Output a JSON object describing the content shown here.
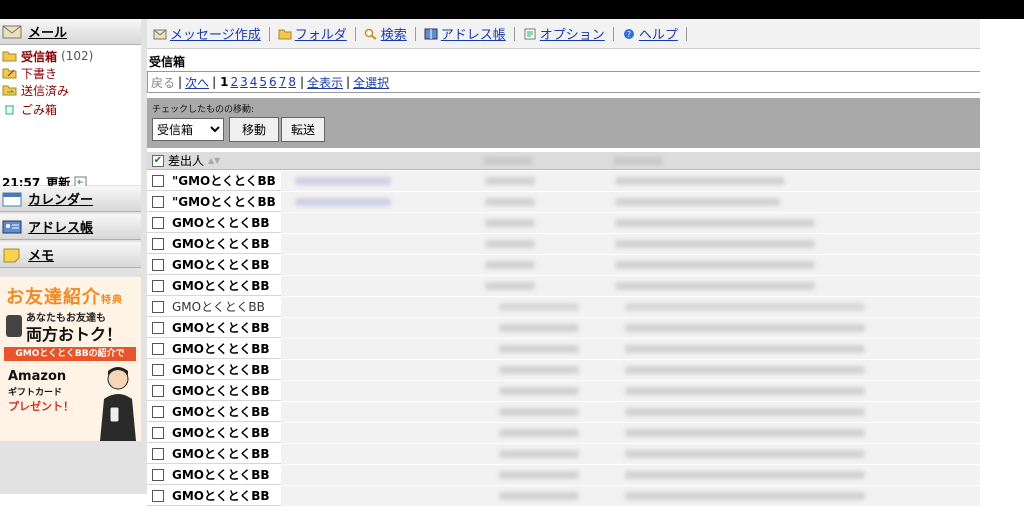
{
  "sidebar": {
    "mail_label": "メール",
    "folders": [
      {
        "name": "受信箱",
        "count": "(102)",
        "bold": true
      },
      {
        "name": "下書き",
        "count": "",
        "bold": false
      },
      {
        "name": "送信済み",
        "count": "",
        "bold": false
      },
      {
        "name": "ごみ箱",
        "count": "",
        "bold": false
      }
    ],
    "update_time": "21:57",
    "update_label": "更新",
    "calendar_label": "カレンダー",
    "addressbook_label": "アドレス帳",
    "memo_label": "メモ",
    "banner": {
      "title": "お友達紹介",
      "title_suffix": "特典",
      "line1": "あなたもお友達も",
      "line2": "両方おトク！",
      "strip": "GMOとくとくBBの紹介で",
      "line3": "Amazon",
      "line4": "ギフトカード",
      "line5": "プレゼント！"
    }
  },
  "toolbar": {
    "items": [
      {
        "label": "メッセージ作成",
        "icon": "compose-icon"
      },
      {
        "label": "フォルダ",
        "icon": "folder-icon"
      },
      {
        "label": "検索",
        "icon": "search-icon"
      },
      {
        "label": "アドレス帳",
        "icon": "addressbook-icon"
      },
      {
        "label": "オプション",
        "icon": "options-icon"
      },
      {
        "label": "ヘルプ",
        "icon": "help-icon"
      }
    ]
  },
  "main": {
    "folder_title": "受信箱",
    "pager": {
      "prev": "戻る",
      "next": "次へ",
      "current": "1",
      "pages": [
        "2",
        "3",
        "4",
        "5",
        "6",
        "7",
        "8"
      ],
      "show_all": "全表示",
      "select_all": "全選択"
    },
    "move": {
      "caption": "チェックしたものの移動:",
      "selected_folder": "受信箱",
      "move_button": "移動",
      "forward_button": "転送"
    },
    "list_header": {
      "sender": "差出人",
      "header_checked": true
    },
    "messages": [
      {
        "from": "\"GMOとくとくBB",
        "read": false
      },
      {
        "from": "\"GMOとくとくBB",
        "read": false
      },
      {
        "from": "GMOとくとくBB",
        "read": false
      },
      {
        "from": "GMOとくとくBB",
        "read": false
      },
      {
        "from": "GMOとくとくBB",
        "read": false
      },
      {
        "from": "GMOとくとくBB",
        "read": false
      },
      {
        "from": "GMOとくとくBB",
        "read": true
      },
      {
        "from": "GMOとくとくBB",
        "read": false
      },
      {
        "from": "GMOとくとくBB",
        "read": false
      },
      {
        "from": "GMOとくとくBB",
        "read": false
      },
      {
        "from": "GMOとくとくBB",
        "read": false
      },
      {
        "from": "GMOとくとくBB",
        "read": false
      },
      {
        "from": "GMOとくとくBB",
        "read": false
      },
      {
        "from": "GMOとくとくBB",
        "read": false
      },
      {
        "from": "GMOとくとくBB",
        "read": false
      },
      {
        "from": "GMOとくとくBB",
        "read": false
      }
    ]
  },
  "colors": {
    "link": "#1a3aa8",
    "folder_text": "#8b0000",
    "move_bar": "#a9a9a9",
    "banner_orange": "#f08a24",
    "banner_red": "#e8542b"
  }
}
